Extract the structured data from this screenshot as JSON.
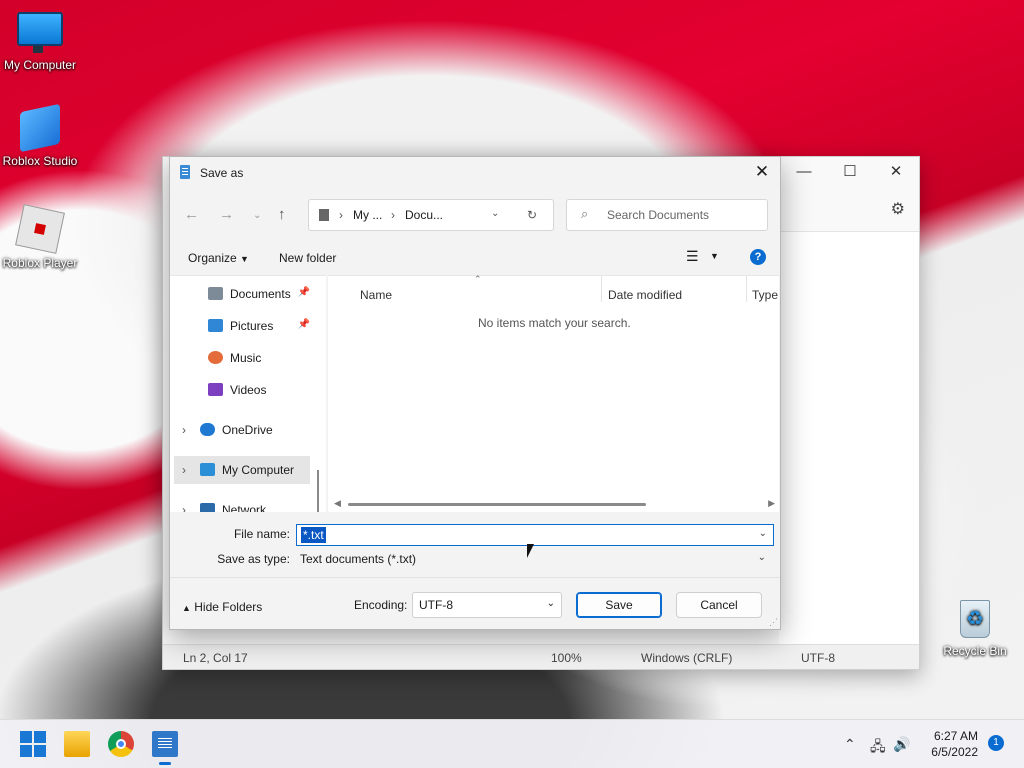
{
  "desktop": {
    "icons": [
      {
        "label": "My Computer"
      },
      {
        "label": "Roblox Studio"
      },
      {
        "label": "Roblox Player"
      },
      {
        "label": "Recycle Bin"
      }
    ]
  },
  "notepad": {
    "status": {
      "position": "Ln 2, Col 17",
      "zoom": "100%",
      "line_ending": "Windows (CRLF)",
      "encoding": "UTF-8"
    }
  },
  "dialog": {
    "title": "Save as",
    "address": {
      "seg1": "My ...",
      "seg2": "Docu..."
    },
    "search_placeholder": "Search Documents",
    "toolbar": {
      "organize": "Organize",
      "new_folder": "New folder"
    },
    "nav_items": [
      {
        "label": "Documents",
        "pinned": true
      },
      {
        "label": "Pictures",
        "pinned": true
      },
      {
        "label": "Music"
      },
      {
        "label": "Videos"
      },
      {
        "label": "OneDrive"
      },
      {
        "label": "My Computer",
        "selected": true
      },
      {
        "label": "Network"
      }
    ],
    "columns": [
      "Name",
      "Date modified",
      "Type"
    ],
    "empty_message": "No items match your search.",
    "file_name_label": "File name:",
    "file_name_value": "*.txt",
    "save_type_label": "Save as type:",
    "save_type_value": "Text documents (*.txt)",
    "hide_folders": "Hide Folders",
    "encoding_label": "Encoding:",
    "encoding_value": "UTF-8",
    "save_button": "Save",
    "cancel_button": "Cancel"
  },
  "taskbar": {
    "time": "6:27 AM",
    "date": "6/5/2022",
    "notification_count": "1"
  },
  "colors": {
    "accent": "#0a6cd1"
  }
}
